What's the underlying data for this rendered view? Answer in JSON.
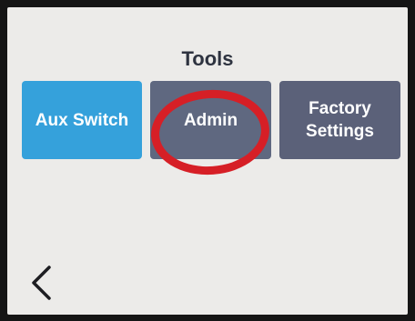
{
  "screen": {
    "title": "Tools"
  },
  "tiles": [
    {
      "label": "Aux Switch",
      "color": "#35a1db"
    },
    {
      "label": "Admin",
      "color": "#5f6880"
    },
    {
      "label": "Factory\nSettings",
      "color": "#5b6179"
    }
  ],
  "nav": {
    "back_icon": "chevron-left-icon"
  },
  "annotation": {
    "highlight_color": "#d61f26",
    "highlighted_item": "Admin"
  }
}
